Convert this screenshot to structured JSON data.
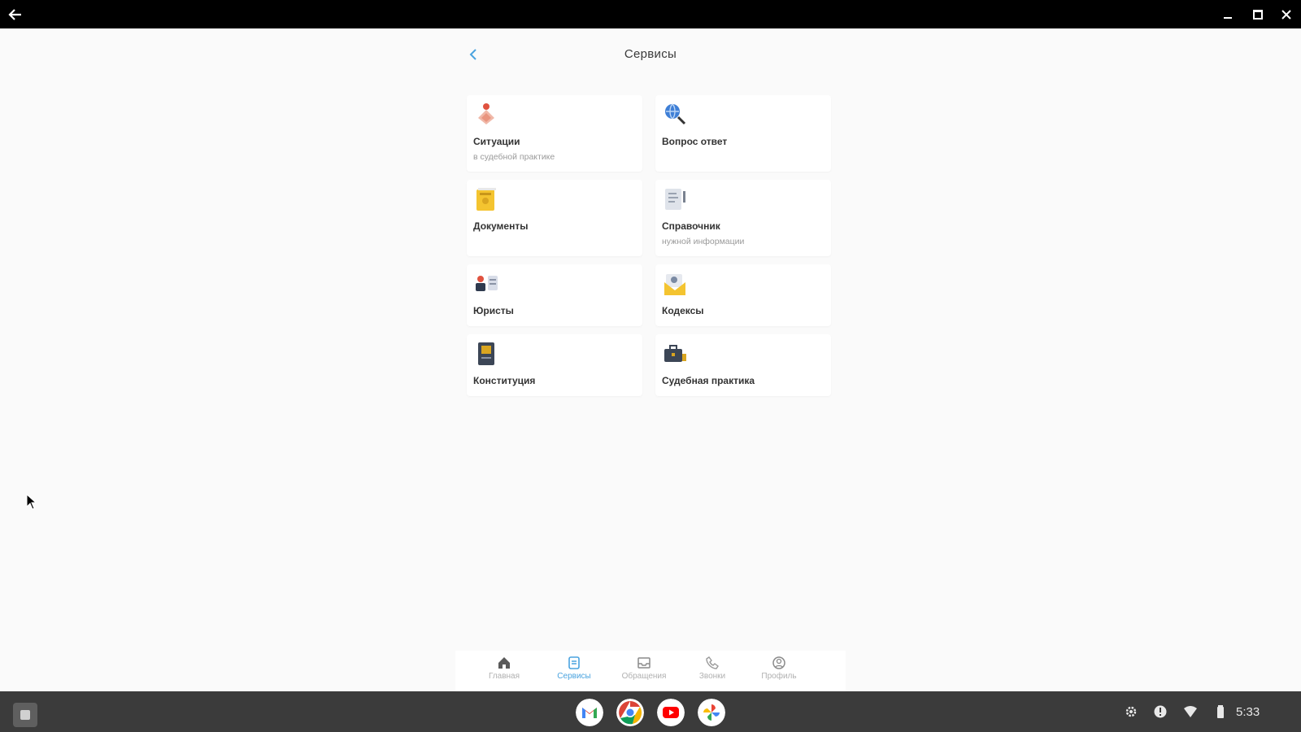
{
  "window": {
    "back_icon": "arrow-left-icon",
    "controls": [
      "minimize-icon",
      "maximize-icon",
      "close-icon"
    ]
  },
  "header": {
    "back_icon": "chevron-left-icon",
    "title": "Сервисы"
  },
  "services": [
    {
      "title": "Ситуации",
      "subtitle": "в судебной практике",
      "icon": "situations-icon"
    },
    {
      "title": "Вопрос ответ",
      "subtitle": "",
      "icon": "search-globe-icon"
    },
    {
      "title": "Документы",
      "subtitle": "",
      "icon": "documents-icon"
    },
    {
      "title": "Справочник",
      "subtitle": "нужной информации",
      "icon": "reference-book-icon"
    },
    {
      "title": "Юристы",
      "subtitle": "",
      "icon": "lawyers-icon"
    },
    {
      "title": "Кодексы",
      "subtitle": "",
      "icon": "codes-envelope-icon"
    },
    {
      "title": "Конституция",
      "subtitle": "",
      "icon": "constitution-book-icon"
    },
    {
      "title": "Судебная практика",
      "subtitle": "",
      "icon": "briefcase-icon"
    }
  ],
  "bottom_nav": [
    {
      "label": "Главная",
      "icon": "home-icon",
      "active": false
    },
    {
      "label": "Сервисы",
      "icon": "services-icon",
      "active": true
    },
    {
      "label": "Обращения",
      "icon": "inbox-icon",
      "active": false
    },
    {
      "label": "Звонки",
      "icon": "phone-icon",
      "active": false
    },
    {
      "label": "Профиль",
      "icon": "profile-icon",
      "active": false
    }
  ],
  "taskbar": {
    "apps": [
      "Gmail",
      "Chrome",
      "YouTube",
      "Photos"
    ],
    "tray_icons": [
      "settings-icon",
      "notification-icon",
      "wifi-icon",
      "battery-icon"
    ],
    "time": "5:33"
  },
  "colors": {
    "accent": "#4aa3df",
    "titlebar": "#000000",
    "taskbar": "#3b3b3b",
    "background": "#fafafa"
  }
}
